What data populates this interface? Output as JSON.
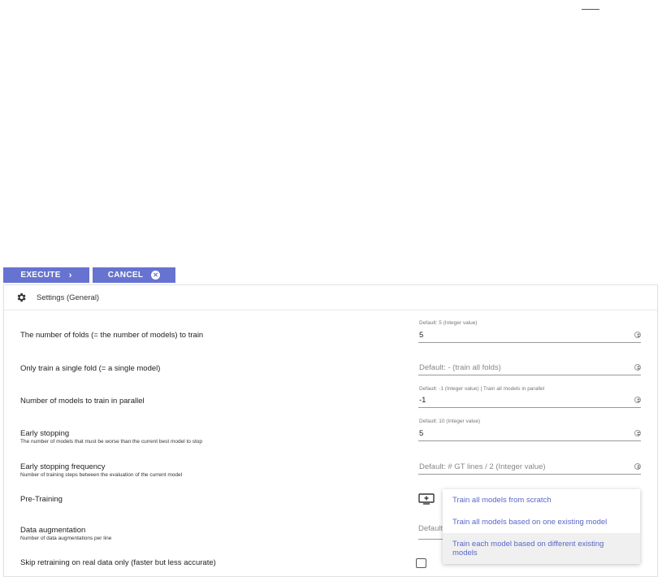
{
  "actions": {
    "execute_label": "EXECUTE",
    "cancel_label": "CANCEL",
    "accent_color": "#6773d0"
  },
  "panel": {
    "title": "Settings (General)"
  },
  "settings": {
    "folds": {
      "label": "The number of folds (= the number of models) to train",
      "hint": "Default: 5 (Integer value)",
      "value": "5"
    },
    "single_fold": {
      "label": "Only train a single fold (= a single model)",
      "placeholder": "Default: - (train all folds)"
    },
    "parallel": {
      "label": "Number of models to train in parallel",
      "hint": "Default: -1 (Integer value) | Train all models in parallel",
      "value": "-1"
    },
    "early_stopping": {
      "label": "Early stopping",
      "description": "The number of models that must be worse than the current best model to stop",
      "hint": "Default: 10 (Integer value)",
      "value": "5"
    },
    "early_stopping_frequency": {
      "label": "Early stopping frequency",
      "description": "Number of training steps between the evaluation of the current model",
      "placeholder": "Default: # GT lines / 2 (Integer value)"
    },
    "pretraining": {
      "label": "Pre-Training",
      "icon": "add-to-queue-icon"
    },
    "data_augmentation": {
      "label": "Data augmentation",
      "description": "Number of data augmentations per line",
      "placeholder": "Default"
    },
    "skip_retraining": {
      "label": "Skip retraining on real data only (faster but less accurate)",
      "checked": false
    }
  },
  "pretraining_menu": {
    "options": [
      "Train all models from scratch",
      "Train all models based on one existing model",
      "Train each model based on different existing models"
    ],
    "highlighted_index": 2,
    "text_color": "#5a66c6"
  }
}
